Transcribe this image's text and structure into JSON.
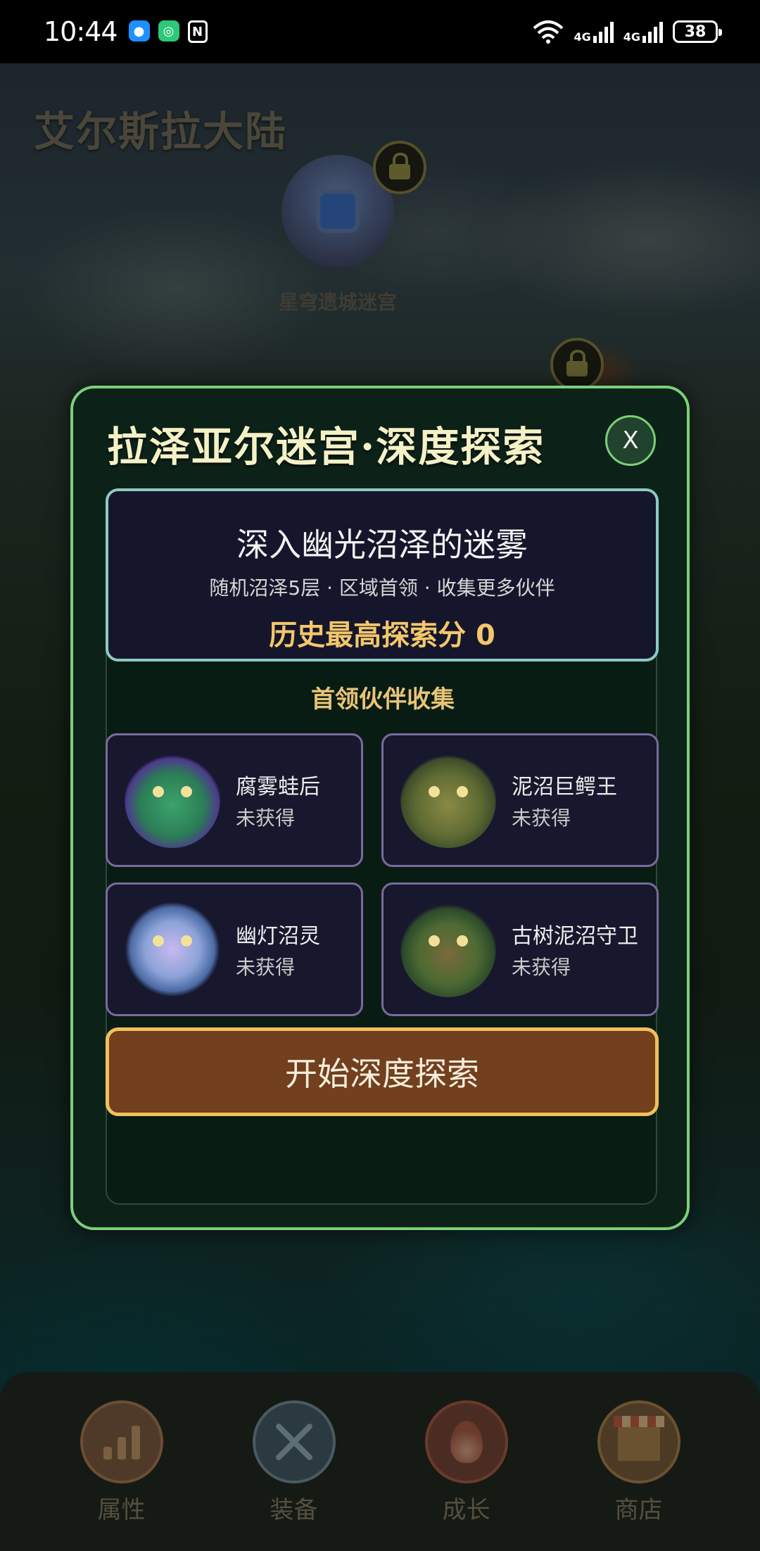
{
  "status_bar": {
    "time": "10:44",
    "signal_labels": [
      "4G",
      "4G"
    ],
    "battery": "38"
  },
  "map": {
    "region_title": "艾尔斯拉大陆",
    "node_label": "星穹遗城迷宫"
  },
  "dialog": {
    "title": "拉泽亚尔迷宫·深度探索",
    "close_label": "X",
    "intro": {
      "heading": "深入幽光沼泽的迷雾",
      "subtitle": "随机沼泽5层 · 区域首领 · 收集更多伙伴",
      "score": "历史最高探索分 0"
    },
    "boss_section_title": "首领伙伴收集",
    "bosses": [
      {
        "name": "腐雾蛙后",
        "status": "未获得",
        "icon": "frog-queen-portrait"
      },
      {
        "name": "泥沼巨鳄王",
        "status": "未获得",
        "icon": "croc-king-portrait"
      },
      {
        "name": "幽灯沼灵",
        "status": "未获得",
        "icon": "lantern-spirit-portrait"
      },
      {
        "name": "古树泥沼守卫",
        "status": "未获得",
        "icon": "tree-guardian-portrait"
      }
    ],
    "start_button": "开始深度探索"
  },
  "bottom_nav": [
    {
      "label": "属性",
      "icon": "stats-icon"
    },
    {
      "label": "装备",
      "icon": "equipment-icon"
    },
    {
      "label": "成长",
      "icon": "growth-flame-icon"
    },
    {
      "label": "商店",
      "icon": "shop-icon"
    }
  ],
  "colors": {
    "dialog_border": "#7ccf79",
    "dialog_bg": "#0c2219",
    "intro_border": "#8ec9c1",
    "score_text": "#f3c76b",
    "boss_card_border": "#7a6a9c",
    "start_button_bg": "#723f1f",
    "start_button_border": "#f2bf5c"
  }
}
